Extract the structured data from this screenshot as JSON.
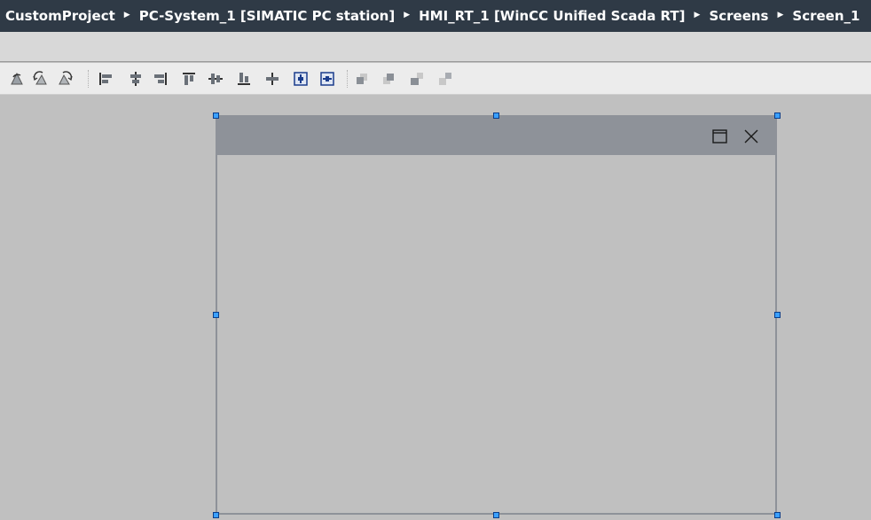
{
  "breadcrumb": {
    "items": [
      "CustomProject",
      "PC-System_1 [SIMATIC PC station]",
      "HMI_RT_1 [WinCC Unified Scada RT]",
      "Screens",
      "Screen_1"
    ],
    "separator": "▶"
  },
  "toolbar": {
    "buttons": [
      "rotate-icon",
      "rotate-left-icon",
      "rotate-right-icon",
      "align-left-icon",
      "align-center-icon",
      "align-right-icon",
      "align-top-icon",
      "align-middle-icon",
      "align-bottom-icon",
      "distribute-icon",
      "same-width-icon",
      "same-height-icon",
      "bring-to-front-icon",
      "send-to-back-icon",
      "bring-forward-icon",
      "send-backward-icon"
    ]
  },
  "popup": {
    "buttons": [
      "maximize-icon",
      "close-icon"
    ]
  },
  "colors": {
    "breadcrumb_bg": "#2f3a46",
    "canvas_bg": "#c0c0c0",
    "titlebar": "#8e9299",
    "handle": "#3aa0ff"
  }
}
